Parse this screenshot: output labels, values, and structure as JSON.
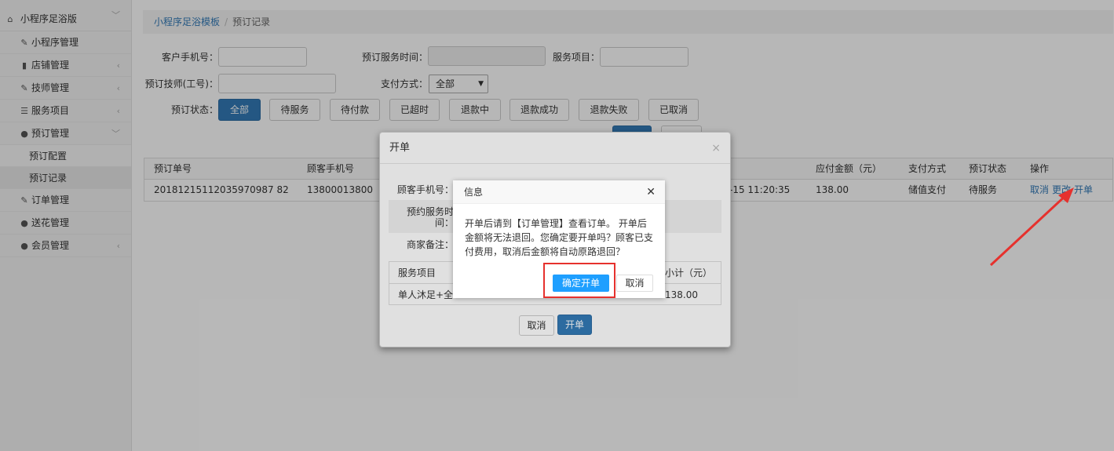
{
  "sidebar": {
    "title": "小程序足浴版",
    "items": [
      {
        "label": "小程序管理",
        "icon": "wrench-icon",
        "arrow": false
      },
      {
        "label": "店铺管理",
        "icon": "bar-chart-icon",
        "arrow": true
      },
      {
        "label": "技师管理",
        "icon": "wrench-icon",
        "arrow": true
      },
      {
        "label": "服务项目",
        "icon": "list-icon",
        "arrow": true
      },
      {
        "label": "预订管理",
        "icon": "user-icon",
        "arrow": true,
        "expanded": true,
        "children": [
          {
            "label": "预订配置"
          },
          {
            "label": "预订记录",
            "active": true
          }
        ]
      },
      {
        "label": "订单管理",
        "icon": "wrench-icon",
        "arrow": false
      },
      {
        "label": "送花管理",
        "icon": "user-icon",
        "arrow": false
      },
      {
        "label": "会员管理",
        "icon": "user-icon",
        "arrow": true
      }
    ]
  },
  "breadcrumb": {
    "link": "小程序足浴模板",
    "sep": "/",
    "current": "预订记录"
  },
  "filters": {
    "phone_label": "客户手机号：",
    "time_label": "预订服务时间：",
    "service_label": "服务项目：",
    "tech_label": "预订技师(工号)：",
    "pay_label": "支付方式：",
    "pay_value": "全部",
    "status_label": "预订状态：",
    "status_buttons": [
      "全部",
      "待服务",
      "待付款",
      "已超时",
      "退款中",
      "退款成功",
      "退款失败",
      "已取消"
    ]
  },
  "table": {
    "headers": [
      "预订单号",
      "顾客手机号",
      "应付金额（元）",
      "支付方式",
      "预订状态",
      "操作"
    ],
    "row": {
      "order_no": "20181215112035970987 82",
      "phone": "13800013800",
      "time_partial": "-15 11:20:35",
      "amount": "138.00",
      "pay": "储值支付",
      "status": "待服务",
      "actions": [
        "取消",
        "更改",
        "开单"
      ]
    }
  },
  "modal_open": {
    "title": "开单",
    "close": "×",
    "phone_label": "顾客手机号：",
    "time_label_1": "预约服务时",
    "time_label_2": "间：",
    "note_label": "商家备注：",
    "tbl_header_service": "服务项目",
    "tbl_header_subtotal": "小计（元）",
    "tbl_service": "单人沐足+全",
    "tbl_subtotal": "138.00",
    "cancel": "取消",
    "confirm": "开单"
  },
  "dialog": {
    "title": "信息",
    "close": "✕",
    "message": "开单后请到【订单管理】查看订单。 开单后金额将无法退回。您确定要开单吗？顾客已支付费用，取消后金额将自动原路退回？",
    "ok": "确定开单",
    "cancel": "取消"
  },
  "colors": {
    "primary": "#337ab7",
    "dialog_ok": "#1e9fff",
    "highlight": "#e6312d"
  }
}
